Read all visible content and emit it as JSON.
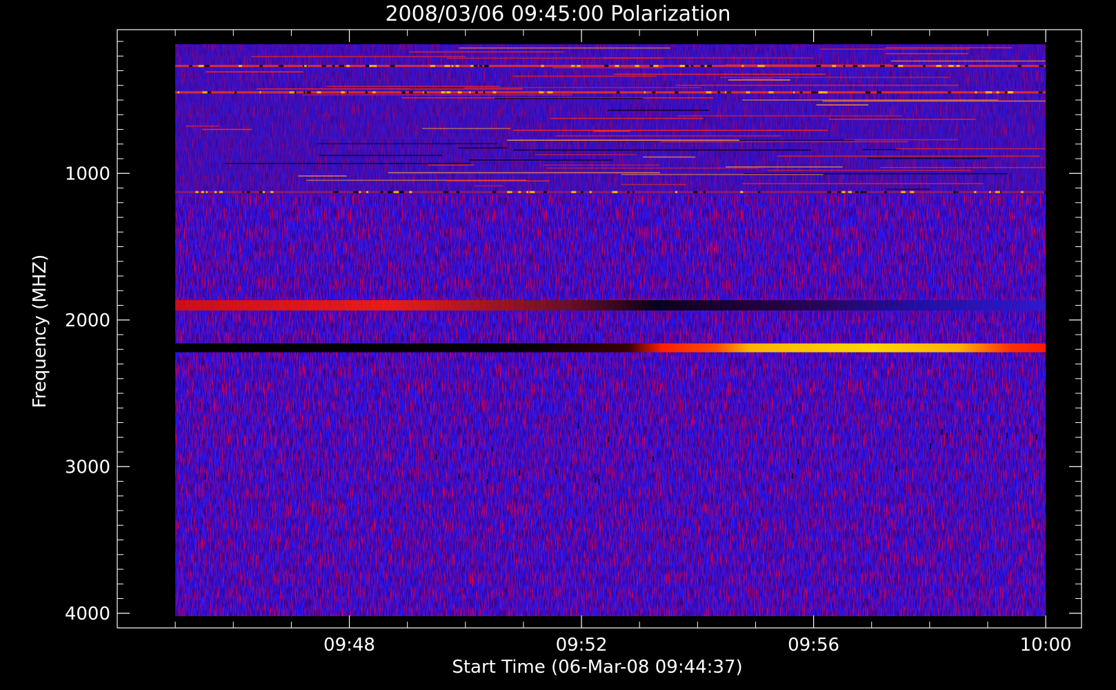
{
  "chart_data": {
    "type": "heatmap",
    "title": "2008/03/06 09:45:00 Polarization",
    "xlabel": "Start Time (06-Mar-08 09:44:37)",
    "ylabel": "Frequency (MHZ)",
    "x_ticks": [
      {
        "label": "09:48",
        "minutes": 3.383
      },
      {
        "label": "09:52",
        "minutes": 7.383
      },
      {
        "label": "09:56",
        "minutes": 11.383
      },
      {
        "label": "10:00",
        "minutes": 15.383
      }
    ],
    "y_ticks": [
      {
        "label": "1000",
        "value": 1000
      },
      {
        "label": "2000",
        "value": 2000
      },
      {
        "label": "3000",
        "value": 3000
      },
      {
        "label": "4000",
        "value": 4000
      }
    ],
    "xlim_minutes": [
      -0.617,
      16.0
    ],
    "ylim": [
      4100,
      20
    ],
    "data_xlim_minutes": [
      0.383,
      15.383
    ],
    "data_ylim": [
      120,
      4020
    ],
    "y_inverted": true,
    "colormap": [
      "#000000",
      "#1c00ff",
      "#ff1a00",
      "#ffd900",
      "#ffff80"
    ],
    "background_level": "#2514ee",
    "features": [
      {
        "name": "noisy low-frequency band",
        "freq_range": [
          120,
          1150
        ],
        "time_range": [
          0.383,
          15.383
        ],
        "level": "mixed"
      },
      {
        "name": "interference line",
        "freq_range": [
          260,
          275
        ],
        "time_range": [
          0.383,
          15.383
        ],
        "level": "high"
      },
      {
        "name": "interference line",
        "freq_range": [
          440,
          455
        ],
        "time_range": [
          0.383,
          15.383
        ],
        "level": "high"
      },
      {
        "name": "interference line",
        "freq_range": [
          1120,
          1135
        ],
        "time_range": [
          0.383,
          15.383
        ],
        "level": "mixed"
      },
      {
        "name": "band near 1880 MHz",
        "freq_range": [
          1865,
          1935
        ],
        "time_range": [
          0.383,
          15.383
        ],
        "level": "red/black"
      },
      {
        "name": "strong band near 2190 MHz",
        "freq_range": [
          2160,
          2220
        ],
        "time_range": [
          0.383,
          15.383
        ],
        "level": "black to yellow",
        "transition_minutes": 9.0
      }
    ]
  }
}
